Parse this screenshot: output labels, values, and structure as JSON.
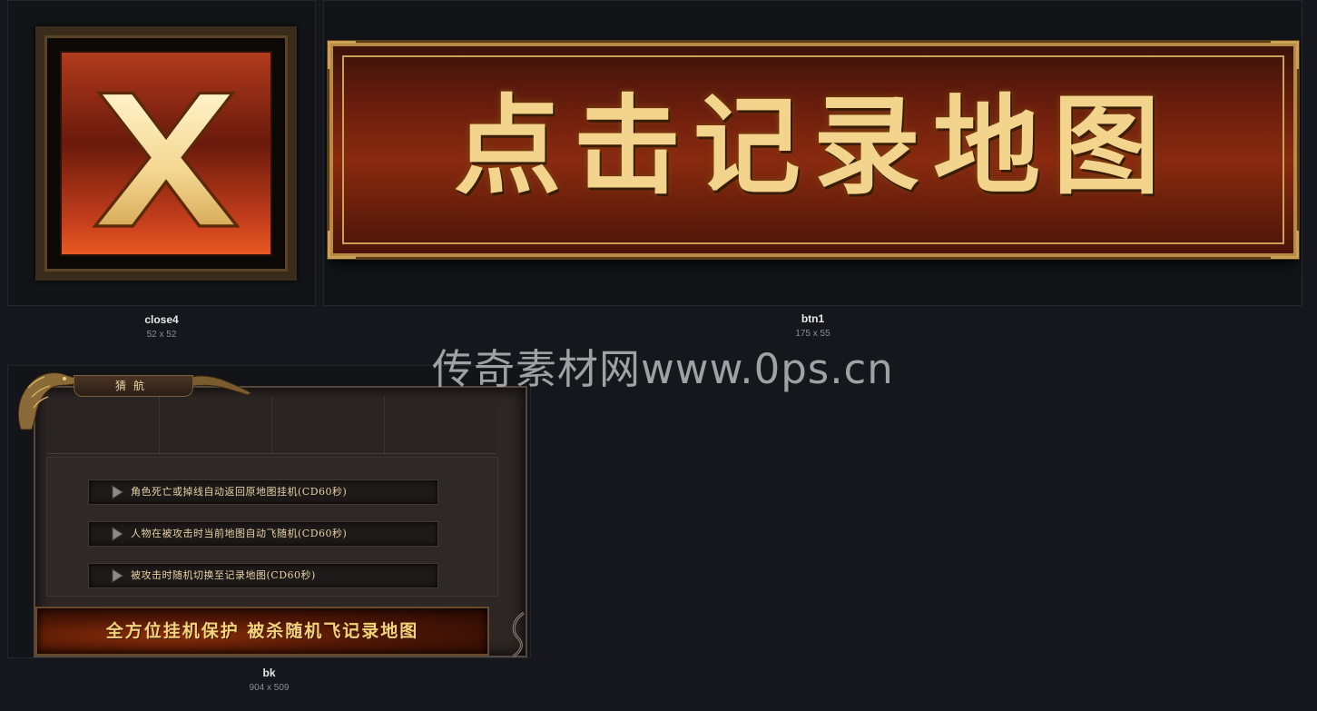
{
  "assets": [
    {
      "name": "close4",
      "size": "52 x 52",
      "glyph": "X"
    },
    {
      "name": "btn1",
      "size": "175 x 55",
      "button_text": "点击记录地图"
    },
    {
      "name": "bk",
      "size": "904 x 509"
    }
  ],
  "watermark": "传奇素材网www.0ps.cn",
  "bk_panel": {
    "tab_label": "猜航",
    "options": [
      "角色死亡或掉线自动返回原地图挂机(CD60秒)",
      "人物在被攻击时当前地图自动飞随机(CD60秒)",
      "被攻击时随机切换至记录地图(CD60秒)"
    ],
    "banner_text": "全方位挂机保护 被杀随机飞记录地图"
  },
  "colors": {
    "page_bg": "#15171c",
    "tile_bg": "#121418",
    "gold": "#f2d48c",
    "red_plate": "#8a2a10"
  }
}
